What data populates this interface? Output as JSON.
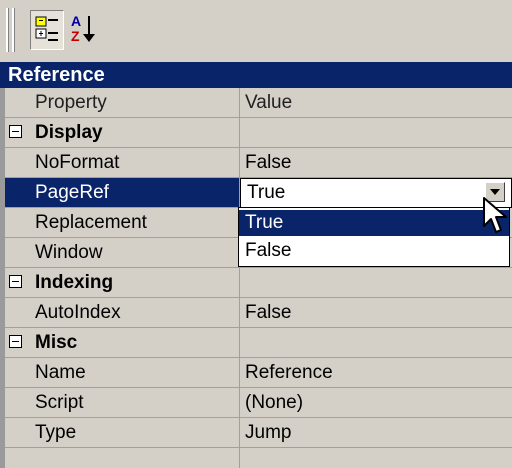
{
  "toolbar": {
    "categorized_icon": "categorized-view-icon",
    "alphabetical_icon": "sort-az-icon"
  },
  "object_name": "Reference",
  "columns": {
    "property": "Property",
    "value": "Value"
  },
  "categories": {
    "display": "Display",
    "indexing": "Indexing",
    "misc": "Misc"
  },
  "rows": {
    "noformat": {
      "property": "NoFormat",
      "value": "False"
    },
    "pageref": {
      "property": "PageRef",
      "value": "True"
    },
    "replacement": {
      "property": "Replacement",
      "value": ""
    },
    "window": {
      "property": "Window",
      "value": ""
    },
    "autoindex": {
      "property": "AutoIndex",
      "value": "False"
    },
    "name": {
      "property": "Name",
      "value": "Reference"
    },
    "script": {
      "property": "Script",
      "value": "(None)"
    },
    "type": {
      "property": "Type",
      "value": "Jump"
    }
  },
  "dropdown": {
    "current": "True",
    "options": [
      "True",
      "False"
    ],
    "highlighted": "True"
  },
  "colors": {
    "selection": "#0a246a",
    "face": "#d4d0c8"
  }
}
